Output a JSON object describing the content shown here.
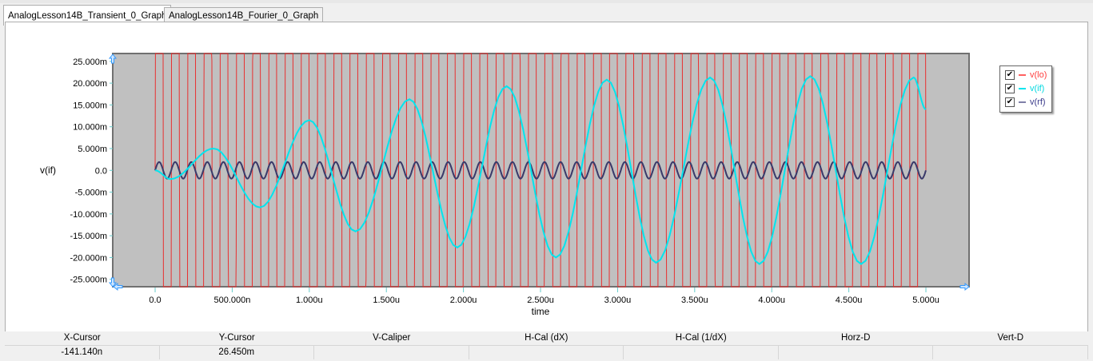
{
  "tabs": [
    {
      "label": "AnalogLesson14B_Transient_0_Graph",
      "active": true
    },
    {
      "label": "AnalogLesson14B_Fourier_0_Graph",
      "active": false
    }
  ],
  "chart_data": {
    "type": "line",
    "xlabel": "time",
    "ylabel": "v(if)",
    "xlim": [
      -0.275,
      5.28
    ],
    "x_unit": "u",
    "ylim": [
      -26.7,
      26.8
    ],
    "y_unit": "m",
    "xticks": [
      {
        "v": 0,
        "label": "0.0"
      },
      {
        "v": 0.5,
        "label": "500.000n"
      },
      {
        "v": 1,
        "label": "1.000u"
      },
      {
        "v": 1.5,
        "label": "1.500u"
      },
      {
        "v": 2,
        "label": "2.000u"
      },
      {
        "v": 2.5,
        "label": "2.500u"
      },
      {
        "v": 3,
        "label": "3.000u"
      },
      {
        "v": 3.5,
        "label": "3.500u"
      },
      {
        "v": 4,
        "label": "4.000u"
      },
      {
        "v": 4.5,
        "label": "4.500u"
      },
      {
        "v": 5,
        "label": "5.000u"
      }
    ],
    "yticks": [
      {
        "v": 25,
        "label": "25.000m"
      },
      {
        "v": 20,
        "label": "20.000m"
      },
      {
        "v": 15,
        "label": "15.000m"
      },
      {
        "v": 10,
        "label": "10.000m"
      },
      {
        "v": 5,
        "label": "5.000m"
      },
      {
        "v": 0,
        "label": "0.0"
      },
      {
        "v": -5,
        "label": "-5.000m"
      },
      {
        "v": -10,
        "label": "-10.000m"
      },
      {
        "v": -15,
        "label": "-15.000m"
      },
      {
        "v": -20,
        "label": "-20.000m"
      },
      {
        "v": -25,
        "label": "-25.000m"
      }
    ],
    "background": "#c0c0c0",
    "grid": false,
    "legend_placement": "right",
    "series": [
      {
        "name": "v(lo)",
        "color": "#e83030",
        "legend_color": "#ff6060",
        "shape": "sine",
        "frequency_MHz": 9.5,
        "amplitude_m": 1000,
        "note_clipped": true
      },
      {
        "name": "v(if)",
        "color": "#00e5ee",
        "legend_color": "#00e5ee",
        "extrema": [
          [
            0,
            0
          ],
          [
            0.1,
            -2
          ],
          [
            0.38,
            5
          ],
          [
            0.68,
            -8.5
          ],
          [
            1.0,
            11.5
          ],
          [
            1.3,
            -14
          ],
          [
            1.65,
            16.3
          ],
          [
            1.96,
            -17.7
          ],
          [
            2.28,
            19.3
          ],
          [
            2.6,
            -20
          ],
          [
            2.93,
            20.8
          ],
          [
            3.25,
            -21.2
          ],
          [
            3.6,
            21.3
          ],
          [
            3.92,
            -21.5
          ],
          [
            4.25,
            21.6
          ],
          [
            4.58,
            -21.5
          ],
          [
            4.92,
            21.3
          ],
          [
            5.0,
            14
          ]
        ]
      },
      {
        "name": "v(rf)",
        "color": "#3a3a6a",
        "legend_color": "#7070a0",
        "shape": "sine",
        "frequency_MHz": 9.6,
        "amplitude_m": 1.9
      }
    ]
  },
  "cursor_table": {
    "headers": [
      "X-Cursor",
      "Y-Cursor",
      "V-Caliper",
      "H-Cal (dX)",
      "H-Cal (1/dX)",
      "Horz-D",
      "Vert-D"
    ],
    "values": [
      "-141.140n",
      "26.450m",
      "",
      "",
      "",
      "",
      ""
    ]
  }
}
